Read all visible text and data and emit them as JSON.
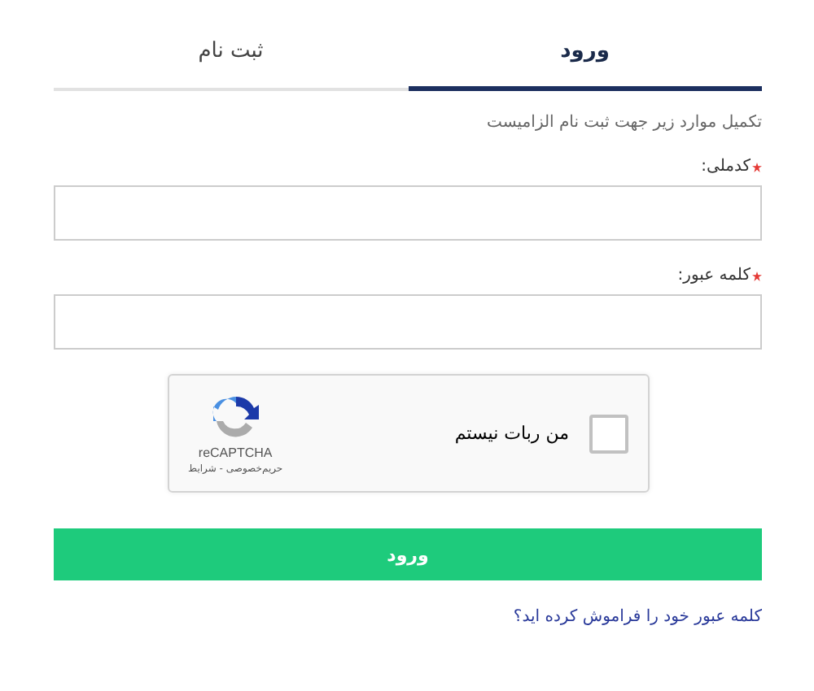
{
  "tabs": [
    {
      "label": "ورود",
      "selected": true
    },
    {
      "label": "ثبت نام",
      "selected": false
    }
  ],
  "subtitle": "تکمیل موارد زیر جهت ثبت نام الزامیست",
  "fields": [
    {
      "label": "کدملی:",
      "required": true
    },
    {
      "label": "کلمه عبور:",
      "required": true
    }
  ],
  "captcha": {
    "label": "من ربات نیستم",
    "checked": false,
    "brand": "reCAPTCHA",
    "links": "حریم‌خصوصی - شرایط"
  },
  "submit": "ورود",
  "forgot_link": "کلمه عبور خود را فراموش کرده اید؟"
}
